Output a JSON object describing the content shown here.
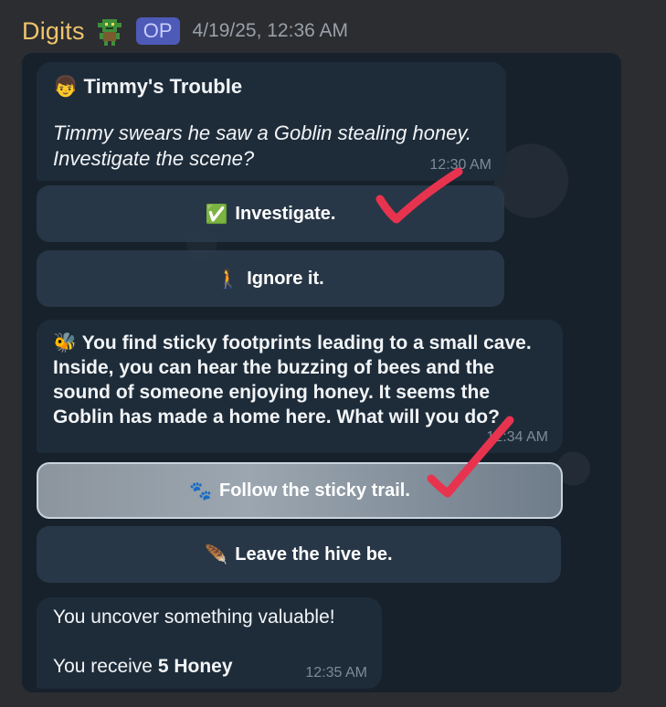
{
  "header": {
    "username": "Digits",
    "badge": "OP",
    "timestamp": "4/19/25, 12:36 AM"
  },
  "messages": [
    {
      "title_icon": "👦",
      "title": "Timmy's Trouble",
      "body": "Timmy swears he saw a Goblin stealing honey. Investigate the scene?",
      "time": "12:30 AM",
      "buttons": [
        {
          "icon": "✅",
          "label": "Investigate."
        },
        {
          "icon": "🚶",
          "label": "Ignore it."
        }
      ]
    },
    {
      "icon": "🐝",
      "body": "You find sticky footprints leading to a small cave. Inside, you can hear the buzzing of bees and the sound of someone enjoying honey. It seems the Goblin has made a home here. What will you do?",
      "time": "12:34 AM",
      "buttons": [
        {
          "icon": "🐾",
          "label": "Follow the sticky trail."
        },
        {
          "icon": "🪶",
          "label": "Leave the hive be."
        }
      ]
    },
    {
      "line1": "You uncover something valuable!",
      "line2_prefix": "You receive ",
      "line2_bold": "5 Honey",
      "time": "12:35 AM"
    }
  ],
  "colors": {
    "username": "#f0c46b",
    "checkmark": "#e8334f",
    "chat_bg": "#17212b"
  }
}
